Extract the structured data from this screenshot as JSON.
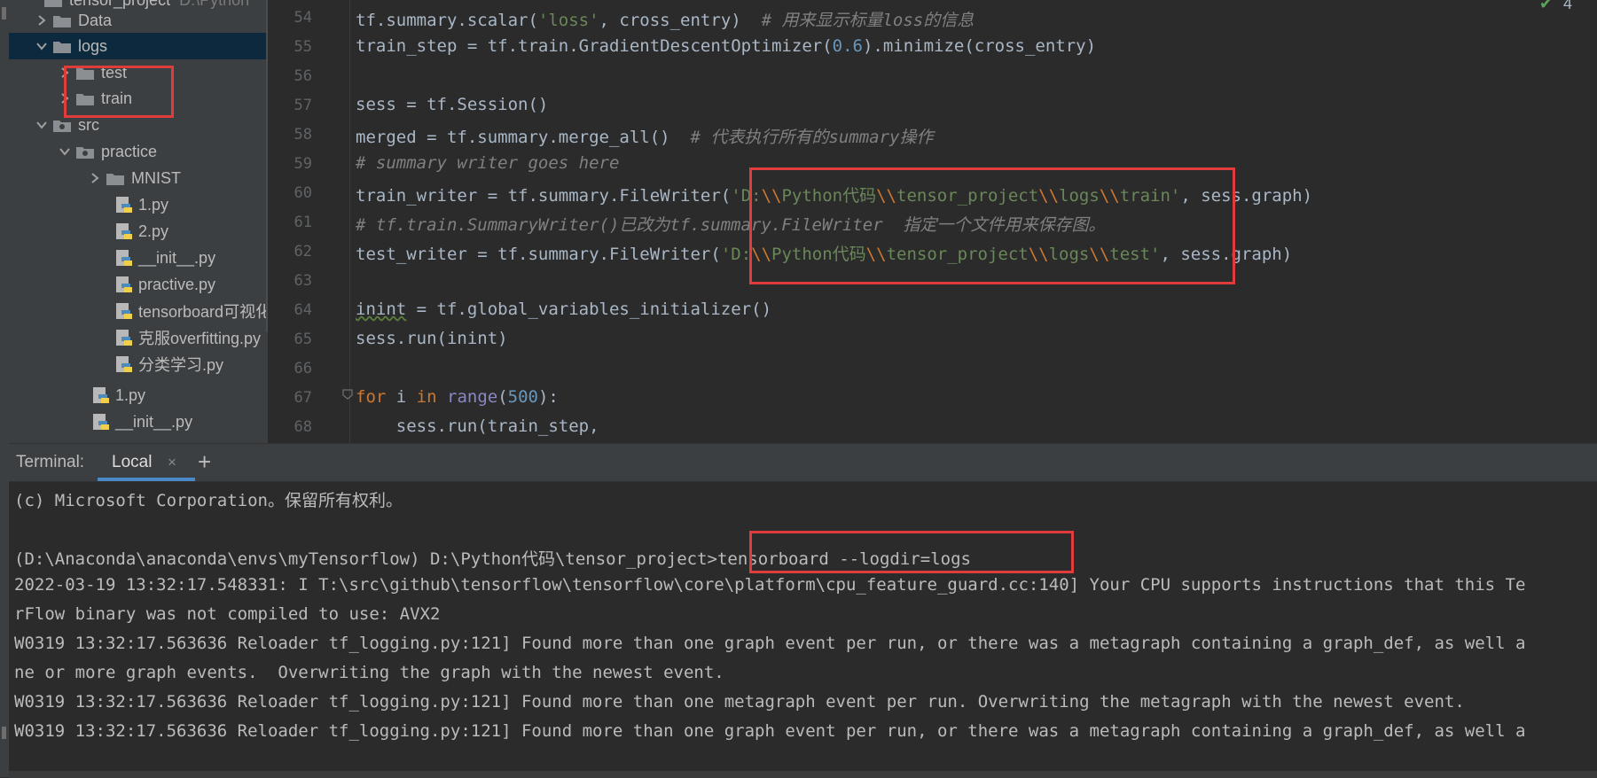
{
  "project_tree": {
    "root_label": "tensor_project",
    "root_hint": "D:\\Python",
    "items": [
      {
        "label": "Data",
        "kind": "folder"
      },
      {
        "label": "logs",
        "kind": "folder"
      },
      {
        "label": "test",
        "kind": "folder"
      },
      {
        "label": "train",
        "kind": "folder"
      },
      {
        "label": "src",
        "kind": "package"
      },
      {
        "label": "practice",
        "kind": "package"
      },
      {
        "label": "MNIST",
        "kind": "folder"
      },
      {
        "label": "1.py",
        "kind": "python"
      },
      {
        "label": "2.py",
        "kind": "python"
      },
      {
        "label": "__init__.py",
        "kind": "python"
      },
      {
        "label": "practive.py",
        "kind": "python"
      },
      {
        "label": "tensorboard可视化",
        "kind": "python"
      },
      {
        "label": "克服overfitting.py",
        "kind": "python"
      },
      {
        "label": "分类学习.py",
        "kind": "python"
      },
      {
        "label": "1.py",
        "kind": "python"
      },
      {
        "label": "__init__.py",
        "kind": "python"
      }
    ]
  },
  "editor": {
    "inspection_count": "4",
    "line_numbers": [
      "54",
      "55",
      "56",
      "57",
      "58",
      "59",
      "60",
      "61",
      "62",
      "63",
      "64",
      "65",
      "66",
      "67",
      "68"
    ],
    "lines": {
      "l54": {
        "a": "tf.summary.scalar(",
        "b": "'loss'",
        "c": ", cross_entry)  ",
        "d": "# 用来显示标量loss的信息"
      },
      "l55": {
        "a": "train_step = tf.train.GradientDescentOptimizer(",
        "b": "0.6",
        "c": ").minimize(cross_entry)"
      },
      "l57": {
        "a": "sess = tf.Session()"
      },
      "l58": {
        "a": "merged = tf.summary.merge_all()  ",
        "b": "# 代表执行所有的summary操作"
      },
      "l59": {
        "a": "# summary writer goes here"
      },
      "l60": {
        "a": "train_writer = tf.summary.FileWriter(",
        "s1": "'D:",
        "e1": "\\\\",
        "s2": "Python代码",
        "e2": "\\\\",
        "s3": "tensor_project",
        "e3": "\\\\",
        "s4": "logs",
        "e4": "\\\\",
        "s5": "train'",
        "c": ", sess.graph)"
      },
      "l61": {
        "a": "# tf.train.SummaryWriter()已改为tf.summary.FileWriter  指定一个文件用来保存图。"
      },
      "l62": {
        "a": "test_writer = tf.summary.FileWriter(",
        "s1": "'D:",
        "e1": "\\\\",
        "s2": "Python代码",
        "e2": "\\\\",
        "s3": "tensor_project",
        "e3": "\\\\",
        "s4": "logs",
        "e4": "\\\\",
        "s5": "test'",
        "c": ", sess.graph)"
      },
      "l64": {
        "a": "inint",
        "b": " = tf.global_variables_initializer()"
      },
      "l65": {
        "a": "sess.run(inint)"
      },
      "l67": {
        "k1": "for",
        "a": " i ",
        "k2": "in",
        "sp": " ",
        "b": "range",
        "c": "(",
        "n": "500",
        "d": "):"
      },
      "l68": {
        "a": "    sess.run(train_step,"
      }
    }
  },
  "terminal": {
    "title": "Terminal:",
    "tab_label": "Local",
    "close_glyph": "×",
    "add_glyph": "+",
    "lines": [
      "(c) Microsoft Corporation。保留所有权利。",
      "",
      "(D:\\Anaconda\\anaconda\\envs\\myTensorflow) D:\\Python代码\\tensor_project>tensorboard --logdir=logs",
      "2022-03-19 13:32:17.548331: I T:\\src\\github\\tensorflow\\tensorflow\\core\\platform\\cpu_feature_guard.cc:140] Your CPU supports instructions that this Te",
      "rFlow binary was not compiled to use: AVX2",
      "W0319 13:32:17.563636 Reloader tf_logging.py:121] Found more than one graph event per run, or there was a metagraph containing a graph_def, as well a",
      "ne or more graph events.  Overwriting the graph with the newest event.",
      "W0319 13:32:17.563636 Reloader tf_logging.py:121] Found more than one metagraph event per run. Overwriting the metagraph with the newest event.",
      "W0319 13:32:17.563636 Reloader tf_logging.py:121] Found more than one graph event per run, or there was a metagraph containing a graph_def, as well a"
    ]
  },
  "colors": {
    "highlight": "#e03c3c",
    "string": "#6a8759",
    "keyword": "#cc7832",
    "number": "#6897bb",
    "comment": "#808080",
    "selection": "#0d293e",
    "tab_underline": "#4a88c7"
  }
}
